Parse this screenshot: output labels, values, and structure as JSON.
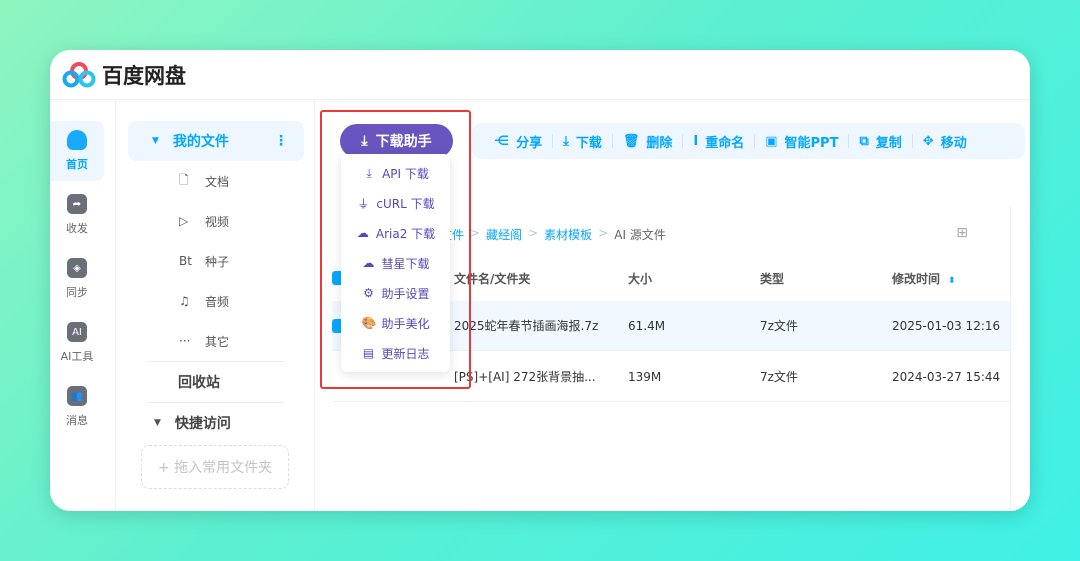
{
  "app": {
    "title": "百度网盘"
  },
  "rail": [
    {
      "label": "首页",
      "icon": "cloud-icon",
      "active": true
    },
    {
      "label": "收发",
      "icon": "share-folder-icon"
    },
    {
      "label": "同步",
      "icon": "sync-icon"
    },
    {
      "label": "AI工具",
      "icon": "ai-icon"
    },
    {
      "label": "消息",
      "icon": "users-icon"
    }
  ],
  "tree": {
    "my_files": "我的文件",
    "items": [
      {
        "icon": "document-icon",
        "glyph": "🗋",
        "label": "文档"
      },
      {
        "icon": "play-icon",
        "glyph": "▷",
        "label": "视频"
      },
      {
        "icon": "bt-icon",
        "glyph": "Bt",
        "label": "种子"
      },
      {
        "icon": "headphones-icon",
        "glyph": "♫",
        "label": "音频"
      },
      {
        "icon": "more-icon",
        "glyph": "···",
        "label": "其它"
      }
    ],
    "recycle": "回收站",
    "quick": "快捷访问",
    "drop_hint": "+ 拖入常用文件夹"
  },
  "toolbar": [
    {
      "icon": "share-icon",
      "glyph": "⋲",
      "label": "分享"
    },
    {
      "icon": "download-icon",
      "glyph": "⤓",
      "label": "下载"
    },
    {
      "icon": "trash-icon",
      "glyph": "🗑",
      "label": "删除"
    },
    {
      "icon": "rename-icon",
      "glyph": "Ⅰ",
      "label": "重命名"
    },
    {
      "icon": "ppt-icon",
      "glyph": "▣",
      "label": "智能PPT"
    },
    {
      "icon": "copy-icon",
      "glyph": "⧉",
      "label": "复制"
    },
    {
      "icon": "move-icon",
      "glyph": "✥",
      "label": "移动"
    }
  ],
  "breadcrumb": [
    "我的文件",
    "藏经阁",
    "素材模板",
    "AI 源文件"
  ],
  "table": {
    "headers": [
      "文件名/文件夹",
      "大小",
      "类型",
      "修改时间"
    ],
    "rows": [
      {
        "name": "2025蛇年春节插画海报.7z",
        "size": "61.4M",
        "type": "7z文件",
        "modified": "2025-01-03 12:16"
      },
      {
        "name": "[PS]+[AI] 272张背景抽...",
        "size": "139M",
        "type": "7z文件",
        "modified": "2024-03-27 15:44"
      }
    ]
  },
  "helper": {
    "button": "下载助手",
    "accent": "#6a55c0",
    "menu": [
      {
        "icon": "download-arrow-icon",
        "glyph": "⤓",
        "label": "API 下载"
      },
      {
        "icon": "plug-icon",
        "glyph": "⏚",
        "label": "cURL 下载"
      },
      {
        "icon": "cloud-download-icon",
        "glyph": "☁",
        "label": "Aria2 下载"
      },
      {
        "icon": "cloud-download-icon",
        "glyph": "☁",
        "label": "彗星下载"
      },
      {
        "icon": "gear-icon",
        "glyph": "⚙",
        "label": "助手设置"
      },
      {
        "icon": "palette-icon",
        "glyph": "🎨",
        "label": "助手美化"
      },
      {
        "icon": "newspaper-icon",
        "glyph": "▤",
        "label": "更新日志"
      }
    ]
  }
}
